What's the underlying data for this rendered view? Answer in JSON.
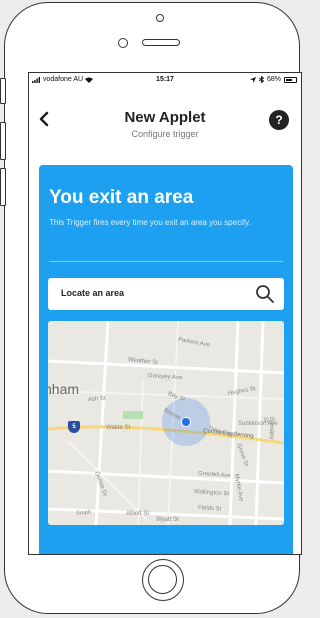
{
  "status_bar": {
    "carrier": "vodafone AU",
    "time": "15:17",
    "battery": "68%",
    "battery_level": 0.68
  },
  "nav": {
    "back_icon": "chevron-left-icon",
    "title": "New Applet",
    "subtitle": "Configure trigger",
    "help_label": "?"
  },
  "card": {
    "color": "#1ea0f0",
    "title": "You exit an area",
    "description": "This Trigger fires every time you exit an area you specify."
  },
  "search": {
    "placeholder": "Locate an area",
    "icon": "search-icon"
  },
  "map": {
    "city_label": "nham",
    "highway_shield": "5",
    "road_label": "Centre Dandenong",
    "street_labels": [
      "Parkers Ave",
      "Weather St",
      "Gareyey Ave",
      "Hughes St",
      "Bay St",
      "Ash St",
      "Blonde St",
      "Walde St",
      "Tanner St",
      "Grove St",
      "Delisle Dr",
      "Grenfell Ave",
      "Myrtle Ave",
      "Wallington St",
      "Smith",
      "Fields St",
      "Albert St",
      "Wyatt St",
      "Sunkinson Ave",
      "Burnaby St"
    ],
    "marker_color": "#1e73e8"
  }
}
